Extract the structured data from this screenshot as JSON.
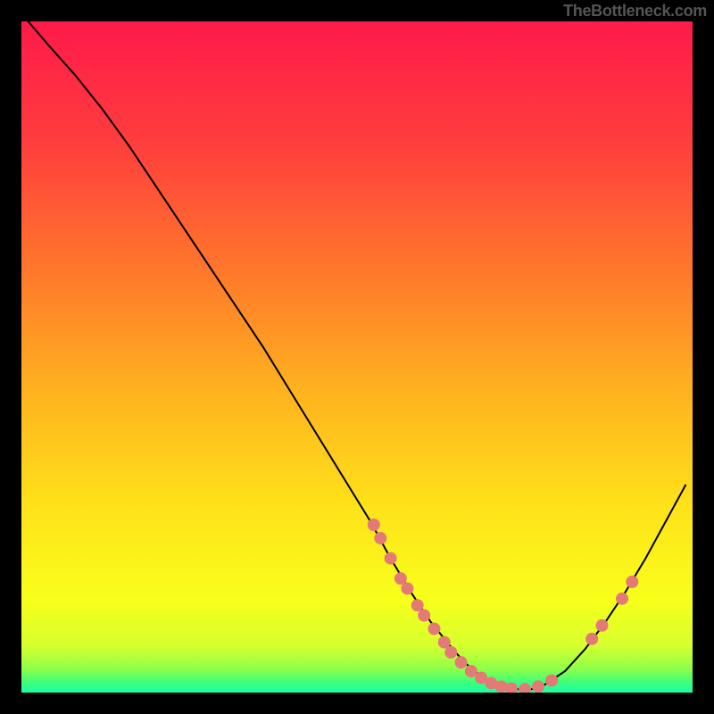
{
  "watermark": "TheBottleneck.com",
  "chart_data": {
    "type": "line",
    "title": "",
    "xlabel": "",
    "ylabel": "",
    "xlim": [
      0,
      100
    ],
    "ylim": [
      0,
      100
    ],
    "grid": false,
    "legend": false,
    "background_gradient_stops": [
      {
        "offset": 0.0,
        "color": "#ff1a4a"
      },
      {
        "offset": 0.18,
        "color": "#ff3d3d"
      },
      {
        "offset": 0.38,
        "color": "#ff7a2a"
      },
      {
        "offset": 0.55,
        "color": "#ffb21f"
      },
      {
        "offset": 0.72,
        "color": "#ffe11a"
      },
      {
        "offset": 0.86,
        "color": "#f8ff1a"
      },
      {
        "offset": 0.93,
        "color": "#d7ff2e"
      },
      {
        "offset": 0.965,
        "color": "#8dff4a"
      },
      {
        "offset": 0.985,
        "color": "#3cff7a"
      },
      {
        "offset": 1.0,
        "color": "#19ffa8"
      }
    ],
    "series": [
      {
        "name": "bottleneck-curve",
        "stroke": "#000000",
        "stroke_width": 2,
        "x": [
          1,
          4,
          8,
          12,
          16,
          20,
          24,
          28,
          32,
          36,
          40,
          44,
          48,
          52,
          55,
          58,
          61,
          64,
          66,
          68,
          70,
          72,
          74,
          76,
          78,
          81,
          84,
          87,
          90,
          93,
          96,
          99
        ],
        "y": [
          100,
          96.5,
          92,
          87,
          81.5,
          75.5,
          69.5,
          63.5,
          57.5,
          51.5,
          45,
          38.5,
          32,
          25.5,
          20,
          15,
          10.5,
          6.8,
          4.5,
          2.8,
          1.6,
          0.9,
          0.5,
          0.5,
          1.2,
          3.2,
          6.5,
          10.5,
          15,
          20,
          25.5,
          31
        ]
      }
    ],
    "points": {
      "name": "sample-dots",
      "fill": "#e47a75",
      "radius": 7,
      "data": [
        {
          "x": 52.5,
          "y": 25.0
        },
        {
          "x": 53.5,
          "y": 23.0
        },
        {
          "x": 55.0,
          "y": 20.0
        },
        {
          "x": 56.5,
          "y": 17.0
        },
        {
          "x": 57.5,
          "y": 15.5
        },
        {
          "x": 59.0,
          "y": 13.0
        },
        {
          "x": 60.0,
          "y": 11.5
        },
        {
          "x": 61.5,
          "y": 9.5
        },
        {
          "x": 63.0,
          "y": 7.5
        },
        {
          "x": 64.0,
          "y": 6.0
        },
        {
          "x": 65.5,
          "y": 4.5
        },
        {
          "x": 67.0,
          "y": 3.2
        },
        {
          "x": 68.5,
          "y": 2.2
        },
        {
          "x": 70.0,
          "y": 1.4
        },
        {
          "x": 71.5,
          "y": 0.9
        },
        {
          "x": 73.0,
          "y": 0.6
        },
        {
          "x": 75.0,
          "y": 0.5
        },
        {
          "x": 77.0,
          "y": 0.9
        },
        {
          "x": 79.0,
          "y": 1.8
        },
        {
          "x": 85.0,
          "y": 8.0
        },
        {
          "x": 86.5,
          "y": 10.0
        },
        {
          "x": 89.5,
          "y": 14.0
        },
        {
          "x": 91.0,
          "y": 16.5
        }
      ]
    }
  }
}
